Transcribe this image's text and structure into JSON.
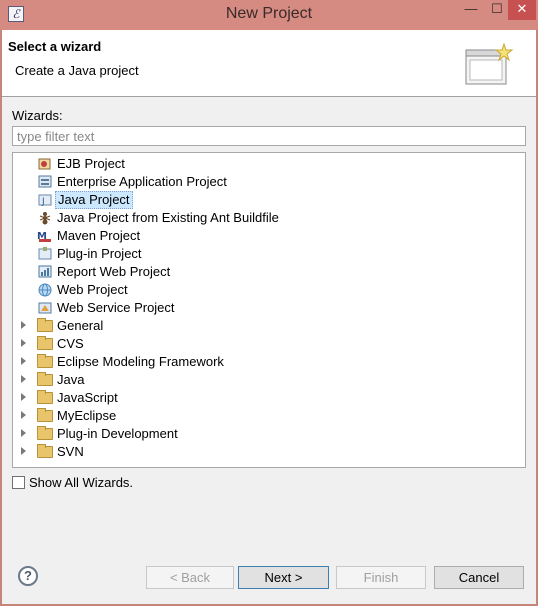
{
  "window": {
    "title": "New Project"
  },
  "banner": {
    "title": "Select a wizard",
    "subtitle": "Create a Java project"
  },
  "wizards_label": "Wizards:",
  "filter": {
    "placeholder": "type filter text",
    "value": ""
  },
  "tree": {
    "items": [
      {
        "label": "EJB Project",
        "icon": "ejb-project-icon",
        "color": "#8a6a3a"
      },
      {
        "label": "Enterprise Application Project",
        "icon": "enterprise-project-icon",
        "color": "#5a7a9a"
      },
      {
        "label": "Java Project",
        "icon": "java-project-icon",
        "color": "#6a8ab0",
        "selected": true
      },
      {
        "label": "Java Project from Existing Ant Buildfile",
        "icon": "ant-icon",
        "color": "#6a4a2a"
      },
      {
        "label": "Maven Project",
        "icon": "maven-icon",
        "color": "#2a4a8a"
      },
      {
        "label": "Plug-in Project",
        "icon": "plugin-project-icon",
        "color": "#6a8ab0"
      },
      {
        "label": "Report Web Project",
        "icon": "report-web-icon",
        "color": "#4a7aa0"
      },
      {
        "label": "Web Project",
        "icon": "web-project-icon",
        "color": "#4a8ac0"
      },
      {
        "label": "Web Service Project",
        "icon": "web-service-icon",
        "color": "#5a7a9a"
      },
      {
        "label": "General",
        "icon": "folder-icon",
        "category": true
      },
      {
        "label": "CVS",
        "icon": "folder-icon",
        "category": true
      },
      {
        "label": "Eclipse Modeling Framework",
        "icon": "folder-icon",
        "category": true
      },
      {
        "label": "Java",
        "icon": "folder-icon",
        "category": true
      },
      {
        "label": "JavaScript",
        "icon": "folder-icon",
        "category": true
      },
      {
        "label": "MyEclipse",
        "icon": "folder-icon",
        "category": true
      },
      {
        "label": "Plug-in Development",
        "icon": "folder-icon",
        "category": true
      },
      {
        "label": "SVN",
        "icon": "folder-icon",
        "category": true
      }
    ]
  },
  "show_all": {
    "label": "Show All Wizards.",
    "checked": false
  },
  "buttons": {
    "back": "< Back",
    "next": "Next >",
    "finish": "Finish",
    "cancel": "Cancel"
  },
  "help_glyph": "?"
}
